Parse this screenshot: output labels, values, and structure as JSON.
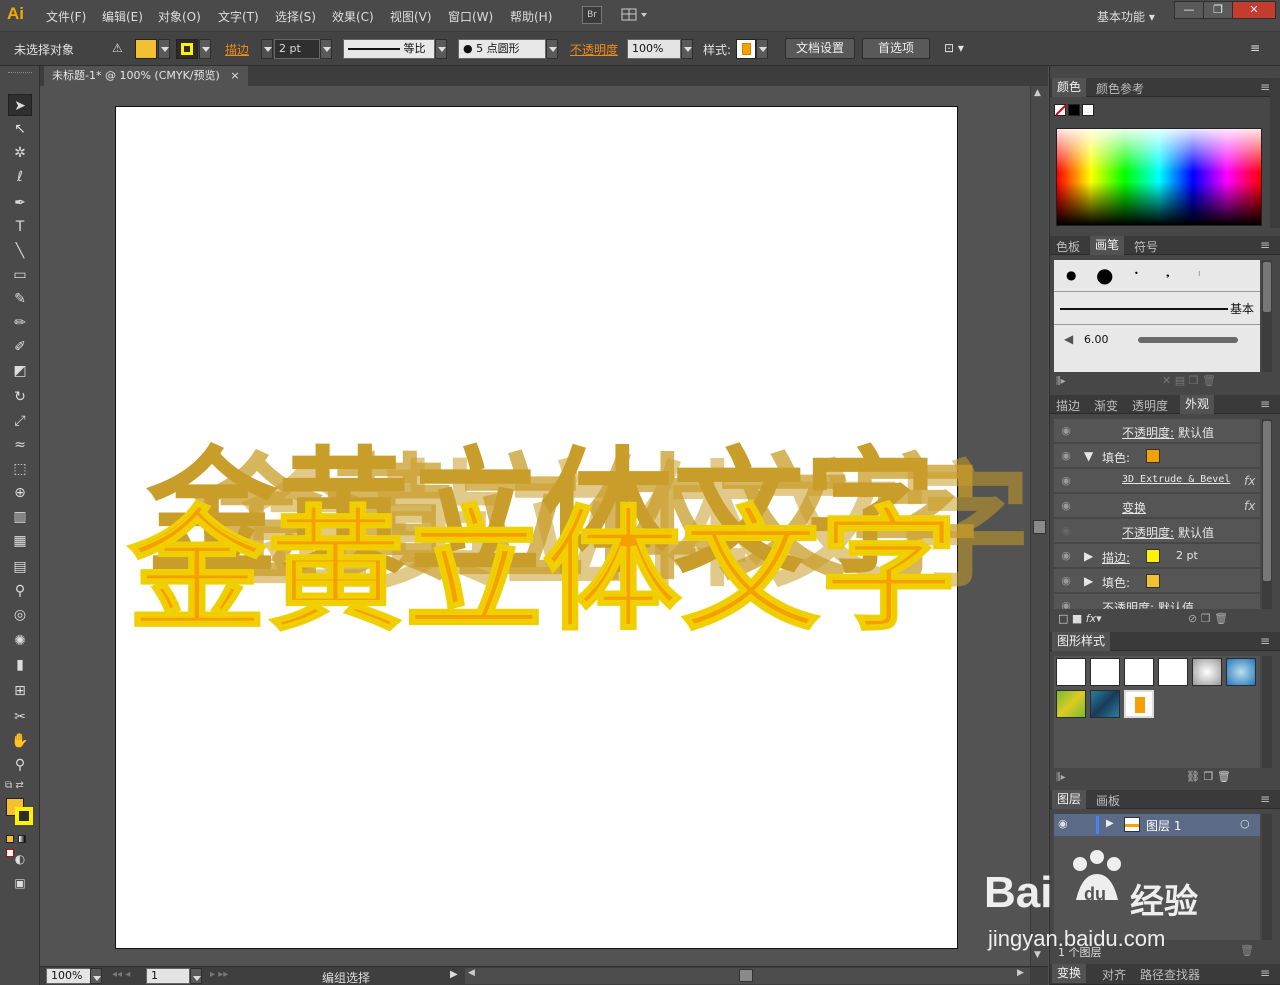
{
  "app": {
    "logo": "Ai",
    "menus": [
      "文件(F)",
      "编辑(E)",
      "对象(O)",
      "文字(T)",
      "选择(S)",
      "效果(C)",
      "视图(V)",
      "窗口(W)",
      "帮助(H)"
    ],
    "bridge_label": "Br",
    "workspace": "基本功能",
    "window_controls": [
      "—",
      "❐",
      "✕"
    ]
  },
  "control_bar": {
    "selection_status": "未选择对象",
    "stroke_label": "描边",
    "stroke_weight": "2 pt",
    "stroke_profile": "等比",
    "brush": "5 点圆形",
    "opacity_label": "不透明度",
    "opacity_value": "100%",
    "style_label": "样式:",
    "doc_setup_button": "文档设置",
    "preferences_button": "首选项",
    "fill_color": "#f2c031",
    "stroke_color": "#fff200"
  },
  "document": {
    "tab_title": "未标题-1* @ 100% (CMYK/预览)",
    "close_glyph": "×",
    "artwork_text": "金黄立体文字",
    "artwork_fill": "#f5a000",
    "artwork_stroke": "#f0d000",
    "extrude_color": "#c99d2a"
  },
  "status_bar": {
    "zoom": "100%",
    "artboard_number": "1",
    "mode": "编组选择"
  },
  "panels": {
    "color_tabs": [
      "颜色",
      "颜色参考"
    ],
    "brush_tabs": [
      "色板",
      "画笔",
      "符号"
    ],
    "brush_basic": "基本",
    "brush_size": "6.00",
    "appearance_tabs": [
      "描边",
      "渐变",
      "透明度",
      "外观"
    ],
    "appearance_rows": [
      {
        "label": "不透明度:",
        "value": "默认值"
      },
      {
        "label": "填色:",
        "value": ""
      },
      {
        "label": "3D Extrude & Bevel",
        "value": "fx"
      },
      {
        "label": "变换",
        "value": "fx"
      },
      {
        "label": "不透明度:",
        "value": "默认值"
      },
      {
        "label": "描边:",
        "value": "2 pt"
      },
      {
        "label": "填色:",
        "value": ""
      },
      {
        "label": "不透明度:",
        "value": "默认值"
      }
    ],
    "graphic_styles_title": "图形样式",
    "layer_tabs": [
      "图层",
      "画板"
    ],
    "layer_name": "图层 1",
    "layer_count": "1 个图层",
    "bottom_tabs": [
      "变换",
      "对齐",
      "路径查找器"
    ]
  },
  "watermark": {
    "brand": "Bai",
    "brand_du": "du",
    "brand_cn": "经验",
    "url": "jingyan.baidu.com"
  }
}
